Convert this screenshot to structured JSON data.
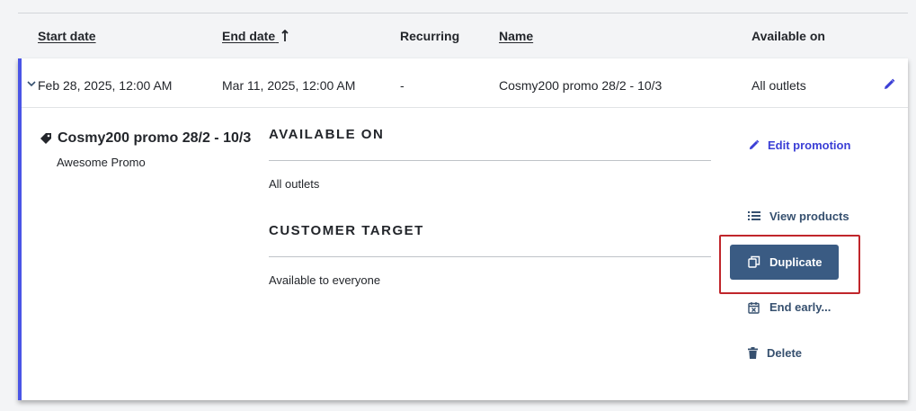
{
  "table": {
    "headers": {
      "start_date": "Start date",
      "end_date": "End date",
      "recurring": "Recurring",
      "name": "Name",
      "available_on": "Available on"
    },
    "row": {
      "start_date": "Feb 28, 2025, 12:00 AM",
      "end_date": "Mar 11, 2025, 12:00 AM",
      "recurring": "-",
      "name": "Cosmy200 promo 28/2 - 10/3",
      "available_on": "All outlets"
    }
  },
  "details": {
    "title": "Cosmy200 promo 28/2 - 10/3",
    "subtitle": "Awesome Promo",
    "available_on_heading": "AVAILABLE ON",
    "available_on_value": "All outlets",
    "customer_target_heading": "CUSTOMER TARGET",
    "customer_target_value": "Available to everyone"
  },
  "actions": {
    "edit": "Edit promotion",
    "view_products": "View products",
    "duplicate": "Duplicate",
    "end_early": "End early...",
    "delete": "Delete"
  },
  "icons": {
    "sort": "arrow-up-icon",
    "expand": "chevron-down-icon",
    "edit": "pencil-icon",
    "tag": "tag-icon",
    "list": "list-icon",
    "copy": "copy-icon",
    "calendar": "calendar-x-icon",
    "trash": "trash-icon"
  },
  "colors": {
    "accent": "#4a55e6",
    "link_blue": "#3b3fd6",
    "slate": "#36506f",
    "button": "#3a5b83",
    "highlight": "#c0262b"
  }
}
